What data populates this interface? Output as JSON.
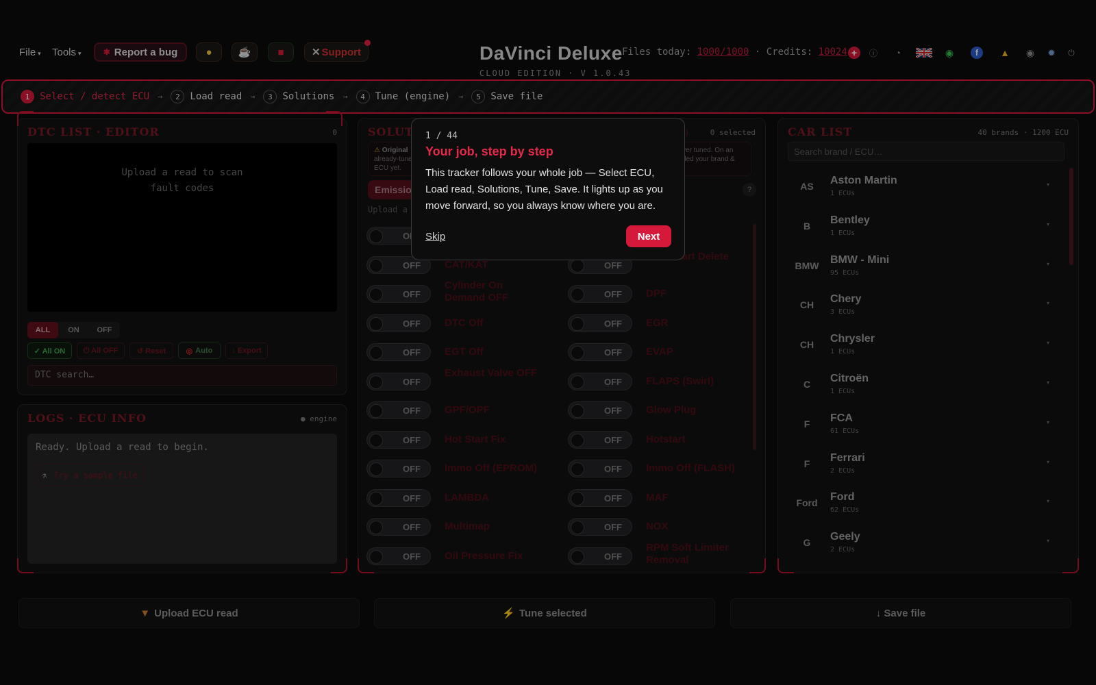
{
  "topbar": {
    "file_menu": "File",
    "tools_menu": "Tools",
    "bug_button": "Report a bug",
    "support_button": "Support",
    "app_title": "DaVinci Deluxe",
    "app_subtitle": "CLOUD EDITION · V 1.0.43",
    "files_today_label": "Files today:",
    "files_today_value": "1000/1000",
    "separator": "·",
    "credits_label": "Credits:",
    "credits_value": "10024",
    "plus": "+"
  },
  "stepper": {
    "steps": [
      {
        "num": "1",
        "label": "Select / detect ECU"
      },
      {
        "num": "2",
        "label": "Load read"
      },
      {
        "num": "3",
        "label": "Solutions"
      },
      {
        "num": "4",
        "label": "Tune (engine)"
      },
      {
        "num": "5",
        "label": "Save file"
      }
    ],
    "arrow": "→"
  },
  "dtc": {
    "title": "DTC LIST · EDITOR",
    "count": "0",
    "empty_line1": "Upload a read to scan",
    "empty_line2": "fault codes",
    "filters": [
      "ALL",
      "ON",
      "OFF"
    ],
    "all_on": "✓ All ON",
    "all_off": "⏻ All OFF",
    "reset": "↺ Reset",
    "auto": "Auto",
    "export": "↓ Export",
    "search_placeholder": "DTC search…"
  },
  "logs": {
    "title": "LOGS · ECU INFO",
    "meta": "● engine",
    "ready": "Ready. Upload a read to begin.",
    "sample_button": "Try a sample file"
  },
  "solutions": {
    "title": "SOLUTIONS",
    "selected": "0 selected",
    "badge_fragment": "n)",
    "warn_a": "Original",
    "warn_b": "already-tune",
    "warn_c": "ECU yet.",
    "warn_d": "ver tuned. On an",
    "warn_e": "ded your brand &",
    "tab": "Emission",
    "hint": "Upload a r",
    "qmark": "?",
    "toggle_off": "OFF",
    "left": [
      "",
      "CAT/KAT",
      "Cylinder On Demand OFF",
      "DTC Off",
      "EGT Off",
      "Exhaust Valve OFF",
      "GPF/OPF",
      "Hot Start Fix",
      "Immo Off (EPROM)",
      "LAMBDA",
      "Multimap",
      "Oil Pressure Fix"
    ],
    "right": [
      "",
      "Cold Start Delete",
      "DPF",
      "EGR",
      "EVAP",
      "FLAPS (Swirl)",
      "Glow Plug",
      "Hotstart",
      "Immo Off (FLASH)",
      "MAF",
      "NOX",
      "RPM Soft Limiter Removal"
    ]
  },
  "cars": {
    "title": "CAR LIST",
    "meta": "40 brands · 1200 ECU",
    "search_placeholder": "Search brand / ECU…",
    "items": [
      {
        "name": "Aston Martin",
        "count": "1 ECUs",
        "logo": "AS"
      },
      {
        "name": "Bentley",
        "count": "1 ECUs",
        "logo": "B"
      },
      {
        "name": "BMW - Mini",
        "count": "95 ECUs",
        "logo": "BMW"
      },
      {
        "name": "Chery",
        "count": "3 ECUs",
        "logo": "CH"
      },
      {
        "name": "Chrysler",
        "count": "1 ECUs",
        "logo": "CH"
      },
      {
        "name": "Citroën",
        "count": "1 ECUs",
        "logo": "C"
      },
      {
        "name": "FCA",
        "count": "61 ECUs",
        "logo": "F"
      },
      {
        "name": "Ferrari",
        "count": "2 ECUs",
        "logo": "F"
      },
      {
        "name": "Ford",
        "count": "62 ECUs",
        "logo": "Ford"
      },
      {
        "name": "Geely",
        "count": "2 ECUs",
        "logo": "G"
      }
    ]
  },
  "bottom": {
    "upload": "Upload ECU read",
    "tune": "Tune selected",
    "save": "↓ Save file"
  },
  "popup": {
    "counter": "1 / 44",
    "title": "Your job, step by step",
    "body": "This tracker follows your whole job — Select ECU, Load read, Solutions, Tune, Save. It lights up as you move forward, so you always know where you are.",
    "skip": "Skip",
    "next": "Next"
  },
  "colors": {
    "accent": "#d4193b",
    "background": "#0c0c0d"
  }
}
